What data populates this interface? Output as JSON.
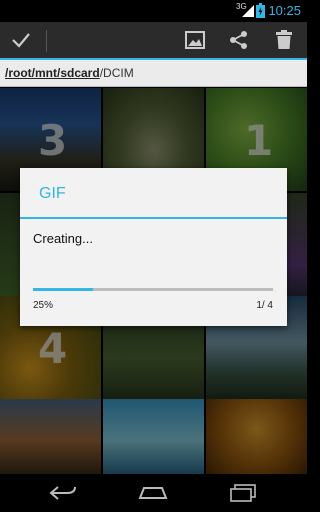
{
  "status": {
    "network": "3G",
    "time": "10:25"
  },
  "path": {
    "segments": [
      "/root/mnt/sdcard"
    ],
    "current": "/DCIM"
  },
  "selection_numbers": [
    "3",
    "1",
    "4"
  ],
  "dialog": {
    "title": "GIF",
    "message": "Creating...",
    "progress_fraction": 0.25,
    "percent_label": "25%",
    "count_label": "1/ 4"
  },
  "icons": {
    "done": "check-icon",
    "image": "image-icon",
    "share": "share-icon",
    "delete": "trash-icon",
    "back": "back-icon",
    "home": "home-icon",
    "recents": "recents-icon"
  },
  "colors": {
    "accent": "#33b5e5",
    "actionbar": "#2b2b2b",
    "dialog_bg": "#f2f2f2"
  }
}
